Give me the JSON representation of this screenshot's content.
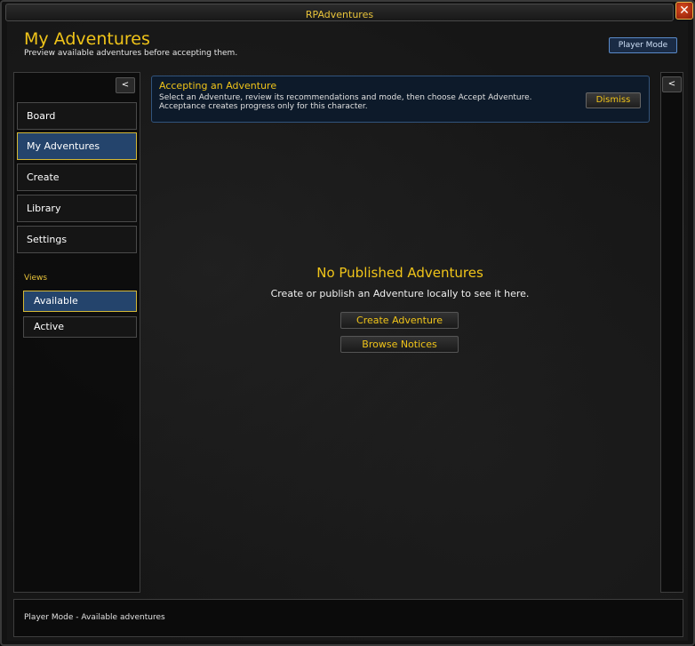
{
  "window": {
    "title": "RPAdventures",
    "close_glyph": "✕"
  },
  "header": {
    "title": "My Adventures",
    "subtitle": "Preview available adventures before accepting them.",
    "mode_button": "Player Mode"
  },
  "sidebar": {
    "collapse_glyph": "<",
    "items": [
      {
        "label": "Board",
        "active": false
      },
      {
        "label": "My Adventures",
        "active": true
      },
      {
        "label": "Create",
        "active": false
      },
      {
        "label": "Library",
        "active": false
      },
      {
        "label": "Settings",
        "active": false
      }
    ],
    "views_label": "Views",
    "views": [
      {
        "label": "Available",
        "active": true
      },
      {
        "label": "Active",
        "active": false
      }
    ]
  },
  "right_panel": {
    "collapse_glyph": "<"
  },
  "banner": {
    "title": "Accepting an Adventure",
    "text": "Select an Adventure, review its recommendations and mode, then choose Accept Adventure. Acceptance creates progress only for this character.",
    "dismiss_label": "Dismiss"
  },
  "empty_state": {
    "title": "No Published Adventures",
    "text": "Create or publish an Adventure locally to see it here.",
    "create_button": "Create Adventure",
    "browse_button": "Browse Notices"
  },
  "status_bar": {
    "text": "Player Mode - Available adventures"
  },
  "colors": {
    "accent_gold": "#f0c419",
    "active_blue": "#24446c",
    "close_red": "#c4361a"
  },
  "icons": {
    "close": "close-icon",
    "collapse": "chevron-left-icon"
  }
}
